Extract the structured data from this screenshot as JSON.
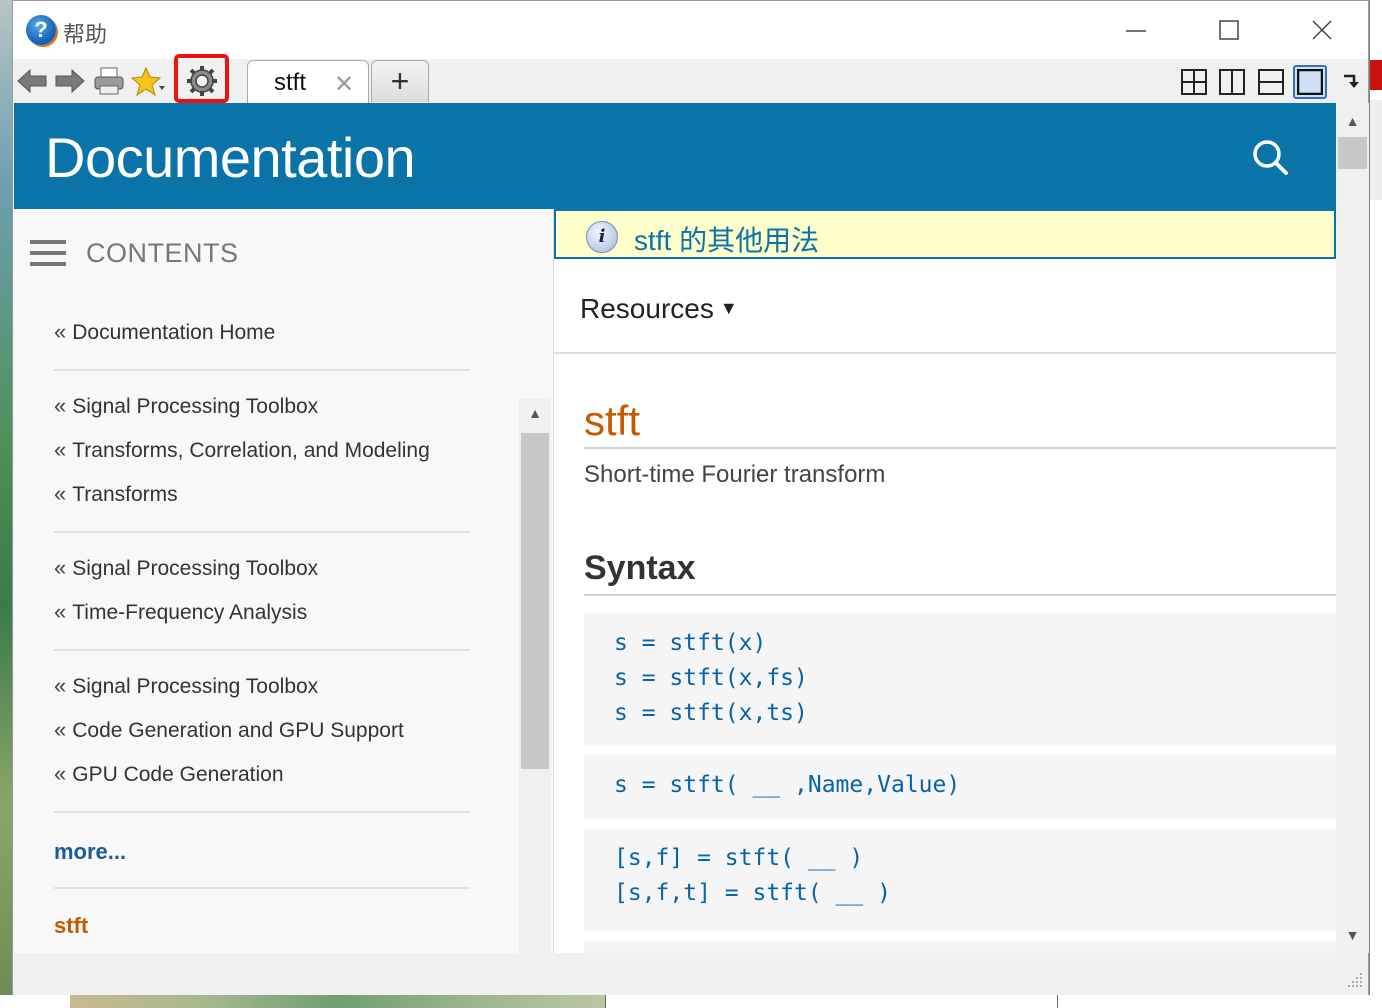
{
  "window": {
    "title": "帮助",
    "app_icon_glyph": "?",
    "controls": [
      "minimize-icon",
      "maximize-icon",
      "close-icon"
    ]
  },
  "toolbar": {
    "icons": [
      "back-arrow-icon",
      "forward-arrow-icon",
      "print-icon",
      "favorites-star-icon",
      "settings-gear-icon"
    ],
    "highlighted": "settings-gear-icon",
    "tab": {
      "label": "stft",
      "close_glyph": "✕"
    },
    "new_tab_glyph": "+",
    "layout_icons": [
      "tile-grid-icon",
      "split-vertical-icon",
      "split-horizontal-icon",
      "single-pane-icon"
    ],
    "active_layout": "single-pane-icon",
    "extra_icon": "undock-arrow-icon"
  },
  "header": {
    "title": "Documentation",
    "search_icon": "search-icon",
    "color": "#0a74a8"
  },
  "sidebar": {
    "heading": "CONTENTS",
    "quote_glyph": "«",
    "groups": [
      [
        "Documentation Home"
      ],
      [
        "Signal Processing Toolbox",
        "Transforms, Correlation, and Modeling",
        "Transforms"
      ],
      [
        "Signal Processing Toolbox",
        "Time-Frequency Analysis"
      ],
      [
        "Signal Processing Toolbox",
        "Code Generation and GPU Support",
        "GPU Code Generation"
      ]
    ],
    "more": "more...",
    "current": "stft"
  },
  "main": {
    "notice": "stft 的其他用法",
    "resources": "Resources",
    "function_name": "stft",
    "description": "Short-time Fourier transform",
    "syntax_heading": "Syntax",
    "code_blocks": [
      [
        "s = stft(x)",
        "s = stft(x,fs)",
        "s = stft(x,ts)"
      ],
      [
        "s = stft( __ ,Name,Value)"
      ],
      [
        "[s,f] = stft( __ )",
        "[s,f,t] = stft( __ )"
      ]
    ]
  },
  "colors": {
    "accent": "#0a74a8",
    "function_name": "#c45b00",
    "code": "#0a62a8",
    "notice_bg": "#ffffcc",
    "highlight_box": "#ee1111"
  }
}
